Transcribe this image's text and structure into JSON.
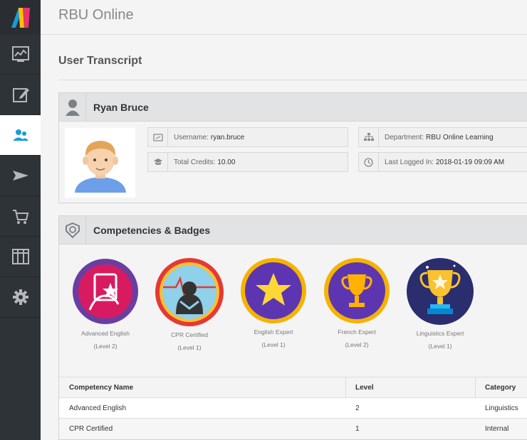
{
  "app": {
    "title": "RBU Online"
  },
  "page": {
    "title": "User Transcript"
  },
  "sidebar": {
    "items": [
      {
        "icon": "dashboard-icon",
        "active": false
      },
      {
        "icon": "edit-icon",
        "active": false
      },
      {
        "icon": "users-icon",
        "active": true
      },
      {
        "icon": "send-icon",
        "active": false
      },
      {
        "icon": "cart-icon",
        "active": false
      },
      {
        "icon": "columns-icon",
        "active": false
      },
      {
        "icon": "gear-icon",
        "active": false
      }
    ]
  },
  "user": {
    "name": "Ryan Bruce",
    "username_label": "Username:",
    "username": "ryan.bruce",
    "credits_label": "Total Credits:",
    "credits": "10.00",
    "department_label": "Department:",
    "department": "RBU Online Learning",
    "last_login_label": "Last Logged In:",
    "last_login": "2018-01-19 09:09 AM"
  },
  "badges_section": {
    "title": "Competencies & Badges",
    "badges": [
      {
        "name": "Advanced English",
        "level": "(Level 2)"
      },
      {
        "name": "CPR Certified",
        "level": "(Level 1)"
      },
      {
        "name": "English Expert",
        "level": "(Level 1)"
      },
      {
        "name": "French Expert",
        "level": "(Level 2)"
      },
      {
        "name": "Linguistics Expert",
        "level": "(Level 1)"
      }
    ]
  },
  "competency_table": {
    "headers": [
      "Competency Name",
      "Level",
      "Category"
    ],
    "rows": [
      [
        "Advanced English",
        "2",
        "Linguistics"
      ],
      [
        "CPR Certified",
        "1",
        "Internal"
      ]
    ]
  },
  "colors": {
    "sidebar_bg": "#2e3338",
    "active_accent": "#1a9bd7",
    "header_bg": "#e1e3e5"
  }
}
